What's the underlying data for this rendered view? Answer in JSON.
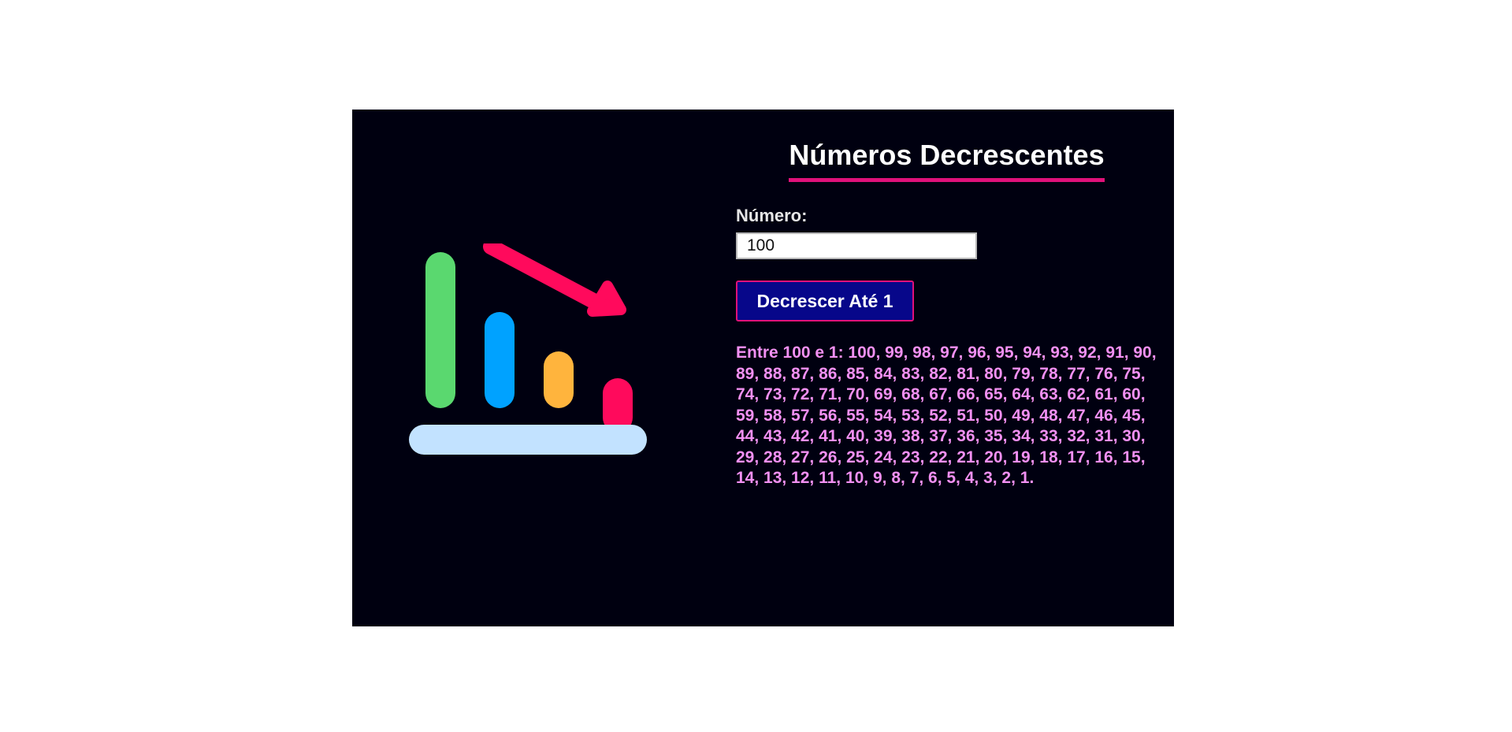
{
  "page": {
    "title": "Números Decrescentes"
  },
  "form": {
    "label": "Número:",
    "input_value": "100",
    "button_label": "Decrescer Até 1"
  },
  "result": {
    "text": "Entre 100 e 1: 100, 99, 98, 97, 96, 95, 94, 93, 92, 91, 90, 89, 88, 87, 86, 85, 84, 83, 82, 81, 80, 79, 78, 77, 76, 75, 74, 73, 72, 71, 70, 69, 68, 67, 66, 65, 64, 63, 62, 61, 60, 59, 58, 57, 56, 55, 54, 53, 52, 51, 50, 49, 48, 47, 46, 45, 44, 43, 42, 41, 40, 39, 38, 37, 36, 35, 34, 33, 32, 31, 30, 29, 28, 27, 26, 25, 24, 23, 22, 21, 20, 19, 18, 17, 16, 15, 14, 13, 12, 11, 10, 9, 8, 7, 6, 5, 4, 3, 2, 1."
  },
  "illustration": {
    "icon": "declining-bar-chart-icon",
    "colors": {
      "bar_1": "#5ad86f",
      "bar_2": "#00a2ff",
      "bar_3": "#ffb43d",
      "bar_4": "#ff0a5c",
      "arrow": "#ff0a5c",
      "base": "#c2e2ff"
    }
  },
  "theme": {
    "card_background": "#000010",
    "title_underline": "#e0117a",
    "button_background": "#07078a",
    "button_border": "#e0117a",
    "result_text": "#f290f2"
  }
}
